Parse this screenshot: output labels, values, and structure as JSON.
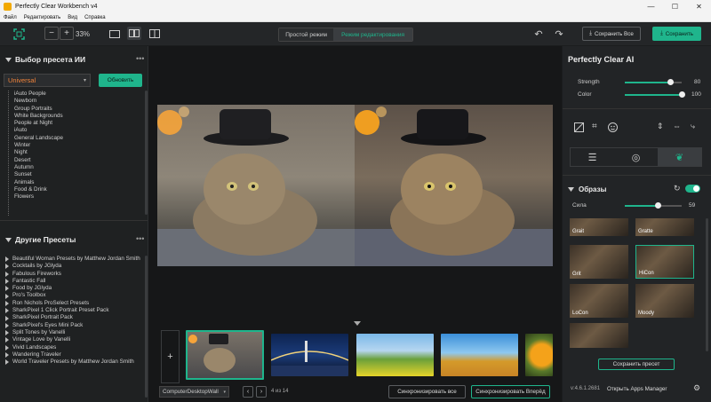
{
  "window": {
    "title": "Perfectly Clear Workbench v4",
    "controls": [
      "—",
      "☐",
      "✕"
    ]
  },
  "menu": [
    "Файл",
    "Редактировать",
    "Вид",
    "Справка"
  ],
  "toolbar": {
    "zoom_minus": "−",
    "zoom_plus": "+",
    "zoom_level": "33%",
    "mode_simple": "Простой режим",
    "mode_edit": "Режим редактирования",
    "save_all": "Сохранить Все",
    "save": "Сохранить"
  },
  "left": {
    "ai_section_title": "Выбор пресета ИИ",
    "preset_select": "Universal",
    "refresh_button": "Обновить",
    "ai_presets": [
      "iAuto People",
      "Newborn",
      "Group Portraits",
      "White Backgrounds",
      "People at Night",
      "iAuto",
      "General Landscape",
      "Winter",
      "Night",
      "Desert",
      "Autumn",
      "Sunset",
      "Animals",
      "Food & Drink",
      "Flowers"
    ],
    "other_section_title": "Другие Пресеты",
    "other_presets": [
      "Beautiful Woman Presets by Matthew Jordan Smith",
      "Cocktails by JGlyda",
      "Fabulous Fireworks",
      "Fantastic Fall",
      "Food by JGlyda",
      "Pro's Toolbox",
      "Ron Nichols ProSelect Presets",
      "SharkPixel 1 Click Portrait Preset Pack",
      "SharkPixel Portrait Pack",
      "SharkPixel's Eyes Mini Pack",
      "Split Tones by Vanelli",
      "Vintage Love by Vanelli",
      "Vivid Landscapes",
      "Wandering Traveler",
      "World Traveler Presets by Matthew Jordan Smith"
    ],
    "more_icon": "more-dots-icon"
  },
  "filmstrip": {
    "add": "+",
    "folder": "ComputerDesktopWall",
    "page_counter": "4 из 14",
    "sync_all": "Синхронизировать все",
    "sync_forward": "Синхронизировать Вперёд"
  },
  "right": {
    "title": "Perfectly Clear AI",
    "strength_label": "Strength",
    "strength_value": "80",
    "strength_fraction": 0.8,
    "color_label": "Color",
    "color_value": "100",
    "color_fraction": 1.0,
    "looks_title": "Образы",
    "sila_label": "Сила",
    "sila_value": "59",
    "sila_fraction": 0.59,
    "looks": [
      "Grait",
      "Gratte",
      "Grit",
      "HiCon",
      "LoCon",
      "Moody",
      ""
    ],
    "save_preset": "Сохранить пресет",
    "version": "v:4.6.1.2681",
    "apps_manager": "Открыть Apps Manager"
  },
  "colors": {
    "accent": "#1fb58c",
    "panel": "#1f2122",
    "selection": "#1fb58c",
    "preset_orange": "#f0833a"
  }
}
